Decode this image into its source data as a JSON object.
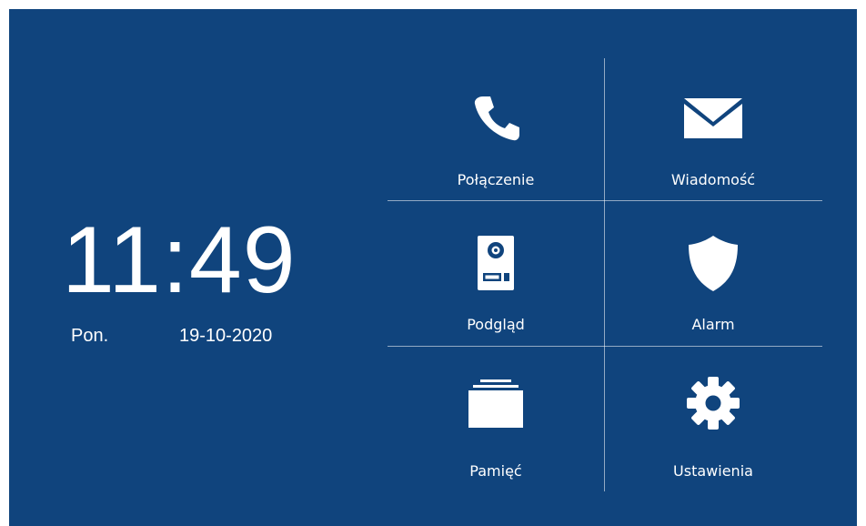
{
  "clock": {
    "time": "11:49",
    "day": "Pon.",
    "date": "19-10-2020"
  },
  "menu": [
    {
      "label": "Połączenie",
      "icon": "phone-icon"
    },
    {
      "label": "Wiadomość",
      "icon": "envelope-icon"
    },
    {
      "label": "Podgląd",
      "icon": "door-station-icon"
    },
    {
      "label": "Alarm",
      "icon": "shield-icon"
    },
    {
      "label": "Pamięć",
      "icon": "memory-stack-icon"
    },
    {
      "label": "Ustawienia",
      "icon": "gear-icon"
    }
  ],
  "colors": {
    "background": "#10447d",
    "foreground": "#ffffff",
    "divider": "#8ea4c0"
  }
}
